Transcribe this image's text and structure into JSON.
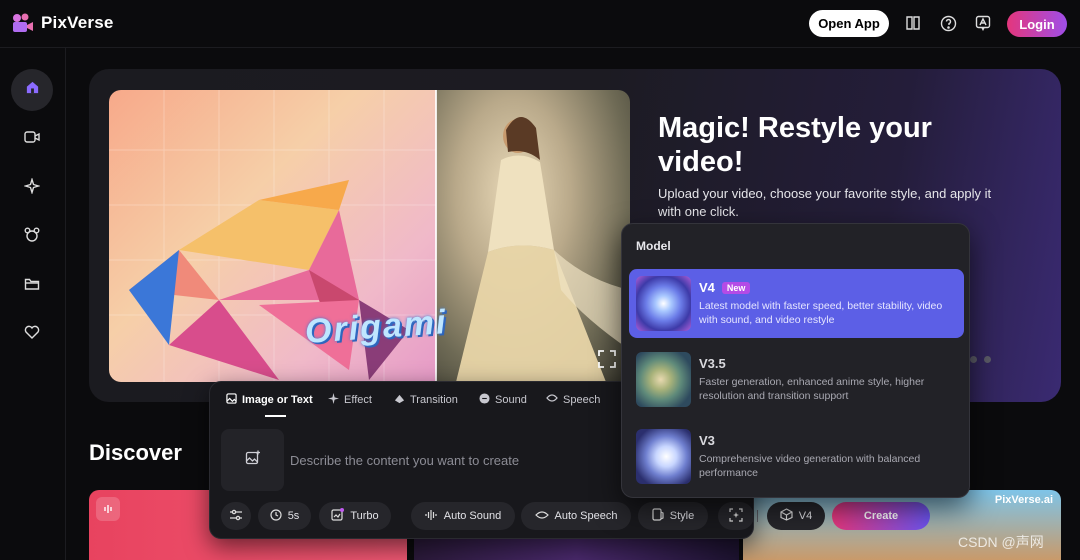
{
  "header": {
    "brand": "PixVerse",
    "open_app": "Open App",
    "login": "Login",
    "icons": [
      "book-icon",
      "help-icon",
      "translate-icon"
    ]
  },
  "sidebar": {
    "items": [
      "home-icon",
      "video-icon",
      "sparkle-icon",
      "character-icon",
      "folder-icon",
      "heart-icon"
    ],
    "active": "home"
  },
  "hero": {
    "title": "Magic! Restyle your video!",
    "description": "Upload your video, choose your favorite style, and apply it with one click.",
    "image_caption": "Origami"
  },
  "discover": {
    "title": "Discover",
    "watermark": "PixVerse.ai"
  },
  "prompt": {
    "tabs": [
      "Image or Text",
      "Effect",
      "Transition",
      "Sound",
      "Speech"
    ],
    "active_tab": "Image or Text",
    "placeholder": "Describe the content you want to create",
    "chips": {
      "duration": "5s",
      "turbo": "Turbo",
      "auto_sound": "Auto Sound",
      "auto_speech": "Auto Speech",
      "style": "Style",
      "model": "V4"
    },
    "create": "Create"
  },
  "model_menu": {
    "header": "Model",
    "items": [
      {
        "name": "V4",
        "badge": "New",
        "desc": "Latest model with faster speed, better stability, video with sound, and video restyle",
        "selected": true
      },
      {
        "name": "V3.5",
        "badge": "",
        "desc": "Faster generation, enhanced anime style, higher resolution and transition support",
        "selected": false
      },
      {
        "name": "V3",
        "badge": "",
        "desc": "Comprehensive video generation with balanced performance",
        "selected": false
      }
    ]
  },
  "page_watermark": "CSDN @声网",
  "colors": {
    "accent_gradient_start": "#e4367c",
    "accent_gradient_end": "#6c54f0",
    "selected_model": "#5c5fe6",
    "background": "#0b0b0d"
  }
}
